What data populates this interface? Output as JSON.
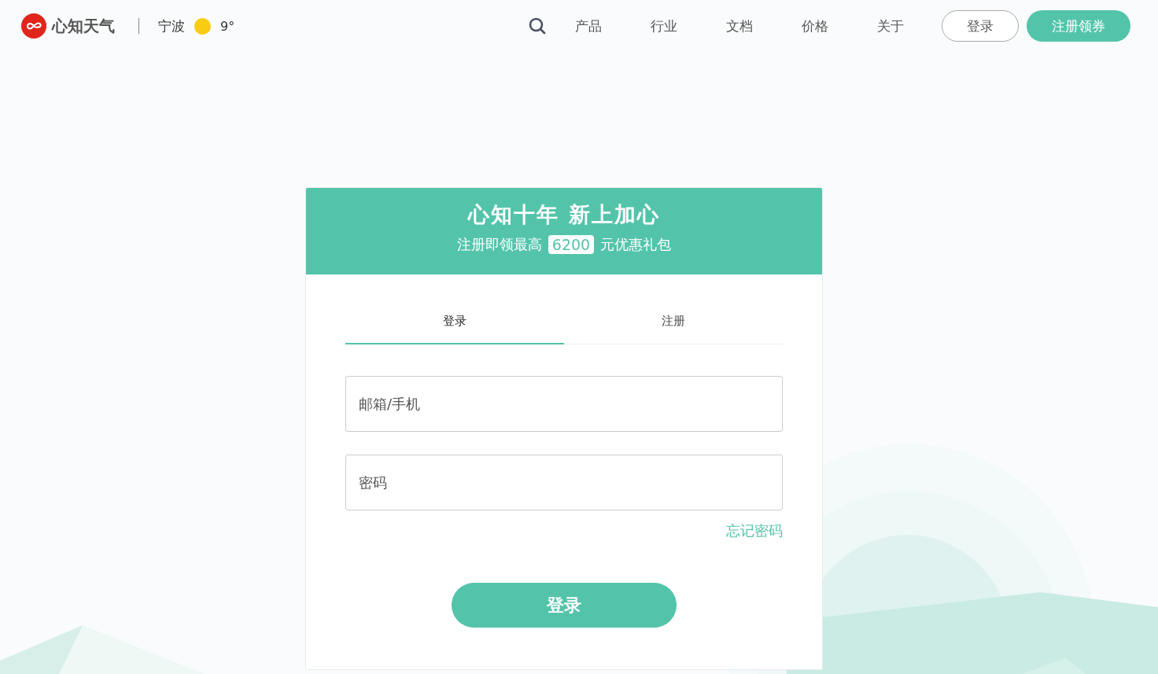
{
  "header": {
    "brand": "心知天气",
    "city": "宁波",
    "temperature": "9°",
    "nav": [
      "产品",
      "行业",
      "文档",
      "价格",
      "关于"
    ],
    "login_button": "登录",
    "register_button": "注册领券"
  },
  "banner": {
    "title": "心知十年 新上加心",
    "subtitle_before": "注册即领最高",
    "amount": "6200",
    "subtitle_after": "元优惠礼包"
  },
  "tabs": [
    {
      "label": "登录",
      "selected": true
    },
    {
      "label": "注册",
      "selected": false
    }
  ],
  "fields": [
    {
      "placeholder": "邮箱/手机"
    },
    {
      "placeholder": "密码"
    }
  ],
  "forgot_link": "忘记密码",
  "submit_button": "登录"
}
